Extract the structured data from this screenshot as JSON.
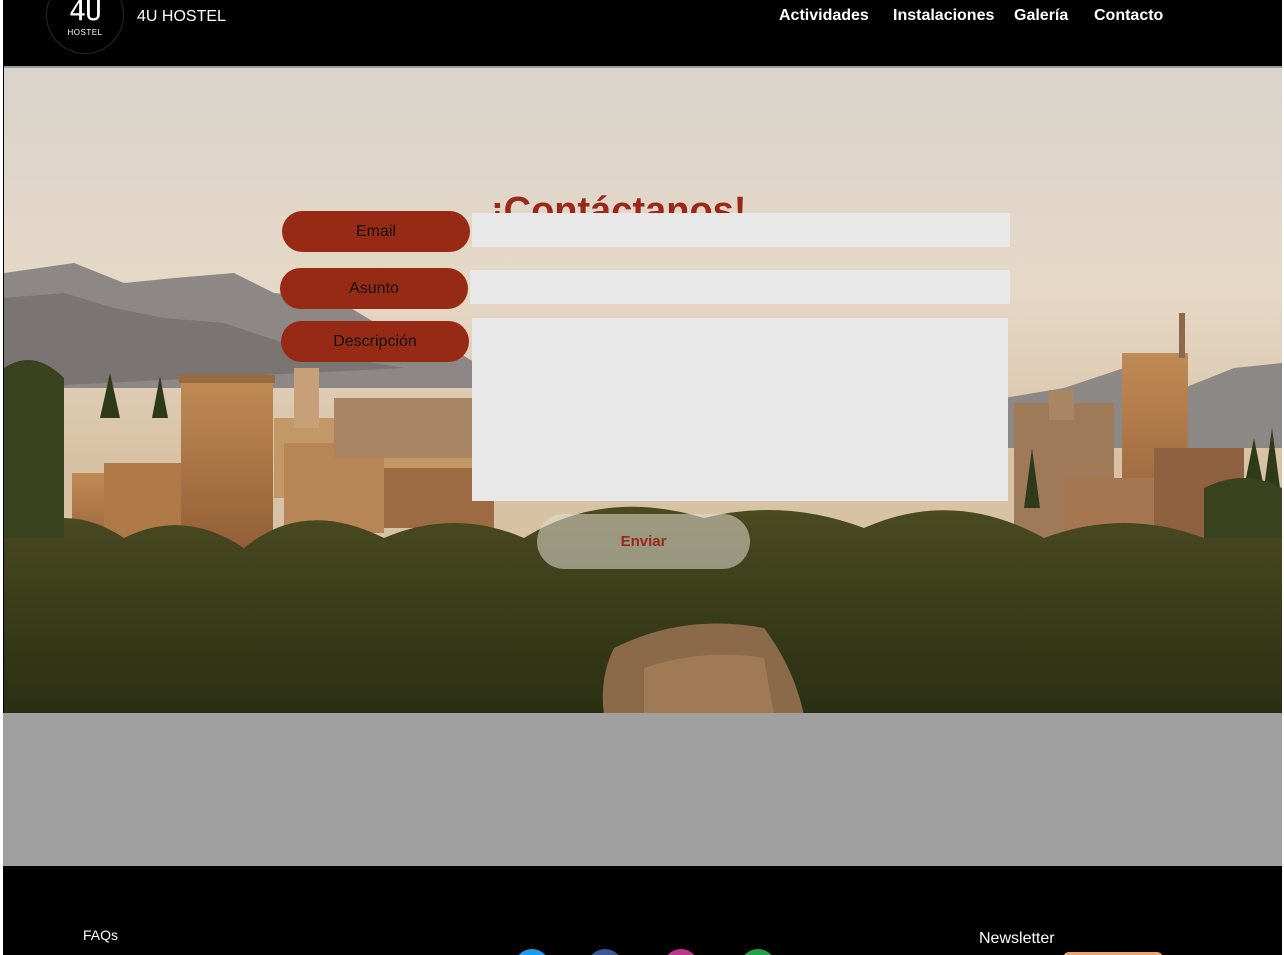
{
  "header": {
    "logo_big": "4U",
    "logo_small": "HOSTEL",
    "brand": "4U HOSTEL",
    "nav": [
      {
        "label": "Actividades"
      },
      {
        "label": "Instalaciones"
      },
      {
        "label": "Galería"
      },
      {
        "label": "Contacto"
      }
    ]
  },
  "contact": {
    "title": "¡Contáctanos!",
    "email_label": "Email",
    "email_value": "",
    "subject_label": "Asunto",
    "subject_value": "",
    "description_label": "Descripción",
    "description_value": "",
    "submit_label": "Enviar"
  },
  "footer": {
    "faq": "FAQs",
    "newsletter": "Newsletter",
    "social_icons": [
      "twitter-icon",
      "facebook-icon",
      "instagram-icon",
      "whatsapp-icon"
    ]
  },
  "colors": {
    "accent": "#98291a",
    "field_bg": "#e8e8e8",
    "band_grey": "#a0a0a0",
    "header_bg": "#000000"
  }
}
